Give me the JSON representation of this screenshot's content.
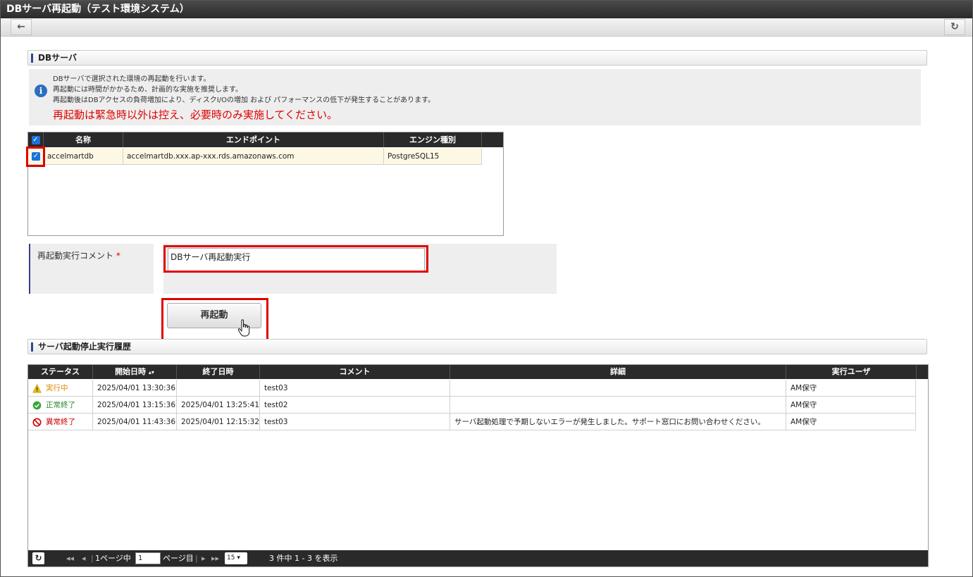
{
  "window": {
    "title": "DBサーバ再起動（テスト環境システム）"
  },
  "toolbar": {
    "back_icon": "back-arrow-icon",
    "reload_icon": "reload-icon"
  },
  "db_section": {
    "title": "DBサーバ",
    "info_lines": [
      "DBサーバで選択された環境の再起動を行います。",
      "再起動には時間がかかるため、計画的な実施を推奨します。",
      "再起動後はDBアクセスの負荷増加により、ディスクI/Oの増加 および パフォーマンスの低下が発生することがあります。"
    ],
    "warning": "再起動は緊急時以外は控え、必要時のみ実施してください。",
    "table": {
      "columns": [
        "名称",
        "エンドポイント",
        "エンジン種別"
      ],
      "rows": [
        {
          "checked": true,
          "name": "accelmartdb",
          "endpoint": "accelmartdb.xxx.ap-xxx.rds.amazonaws.com",
          "engine": "PostgreSQL15"
        }
      ]
    }
  },
  "form": {
    "comment_label": "再起動実行コメント",
    "required_mark": "*",
    "comment_value": "DBサーバ再起動実行",
    "restart_button": "再起動"
  },
  "history_section": {
    "title": "サーバ起動停止実行履歴",
    "columns": [
      "ステータス",
      "開始日時",
      "終了日時",
      "コメント",
      "詳細",
      "実行ユーザ"
    ],
    "sort_icon": "sort-icon",
    "rows": [
      {
        "status": "実行中",
        "status_color": "#e08a00",
        "icon": "warning-icon",
        "start": "2025/04/01 13:30:36",
        "end": "",
        "comment": "test03",
        "detail": "",
        "user": "AM保守"
      },
      {
        "status": "正常終了",
        "status_color": "#2a8a2a",
        "icon": "check-circle-icon",
        "start": "2025/04/01 13:15:36",
        "end": "2025/04/01 13:25:41",
        "comment": "test02",
        "detail": "",
        "user": "AM保守"
      },
      {
        "status": "異常終了",
        "status_color": "#d00000",
        "icon": "prohibited-icon",
        "start": "2025/04/01 11:43:36",
        "end": "2025/04/01 12:15:32",
        "comment": "test03",
        "detail": "サーバ起動処理で予期しないエラーが発生しました。サポート窓口にお問い合わせください。",
        "user": "AM保守"
      }
    ],
    "pager": {
      "page_prefix": "1ページ中",
      "page_value": "1",
      "page_suffix": "ページ目",
      "page_size": "15",
      "summary": "3 件中 1 - 3 を表示"
    }
  }
}
